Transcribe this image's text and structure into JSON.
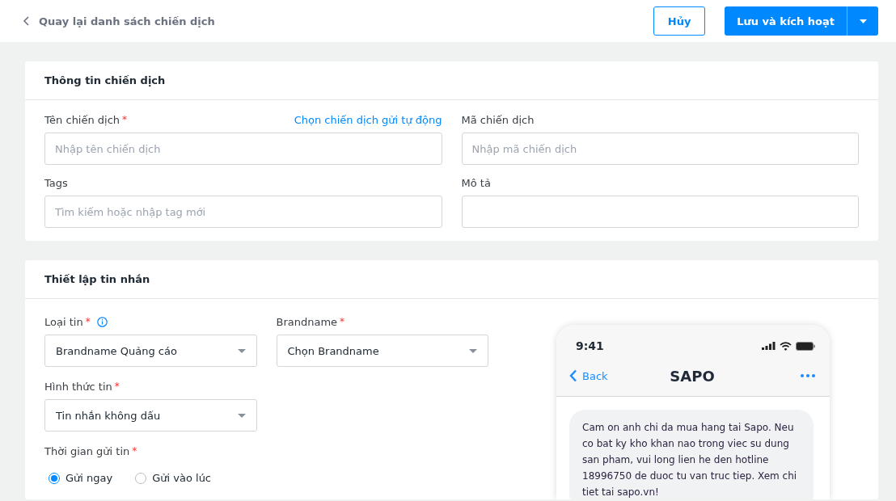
{
  "header": {
    "back_label": "Quay lại danh sách chiến dịch",
    "buttons": [
      {
        "label": "Hủy",
        "kind": "secondary"
      },
      {
        "label": "Lưu và kích hoạt",
        "kind": "primary"
      }
    ]
  },
  "campaign_info": {
    "title": "Thông tin chiến dịch",
    "fields": [
      {
        "label": "Tên chiến dịch",
        "required_mark": "*",
        "link": "Chọn chiến dịch gửi tự động",
        "placeholder": "Nhập tên chiến dịch"
      },
      {
        "label": "Mã chiến dịch",
        "placeholder": "Nhập mã chiến dịch"
      },
      {
        "label": "Tags",
        "placeholder": "Tìm kiếm hoặc nhập tag mới"
      },
      {
        "label": "Mô tả"
      }
    ]
  },
  "message_setup": {
    "title": "Thiết lập tin nhắn",
    "rows": [
      [
        {
          "kind": "select",
          "label": "Loại tin",
          "required_mark": "*",
          "info": true,
          "value": "Brandname Quảng cáo"
        },
        {
          "kind": "select",
          "label": "Brandname",
          "required_mark": "*",
          "value": "Chọn Brandname"
        }
      ],
      [
        {
          "kind": "select",
          "label": "Hình thức tin",
          "required_mark": "*",
          "value": "Tin nhắn không dấu"
        }
      ],
      [
        {
          "kind": "radio",
          "label": "Thời gian gửi tin",
          "required_mark": "*",
          "options": [
            {
              "label": "Gửi ngay",
              "selected": true
            },
            {
              "label": "Gửi vào lúc",
              "selected": false
            }
          ]
        }
      ]
    ],
    "phone": {
      "time": "9:41",
      "back": "Back",
      "title": "SAPO",
      "message": "Cam on anh chi da mua hang tai Sapo. Neu co bat ky kho khan nao trong viec su dung san pham, vui long lien he den hotline 18996750 de duoc tu van truc tiep. Xem chi tiet tai sapo.vn!"
    }
  }
}
